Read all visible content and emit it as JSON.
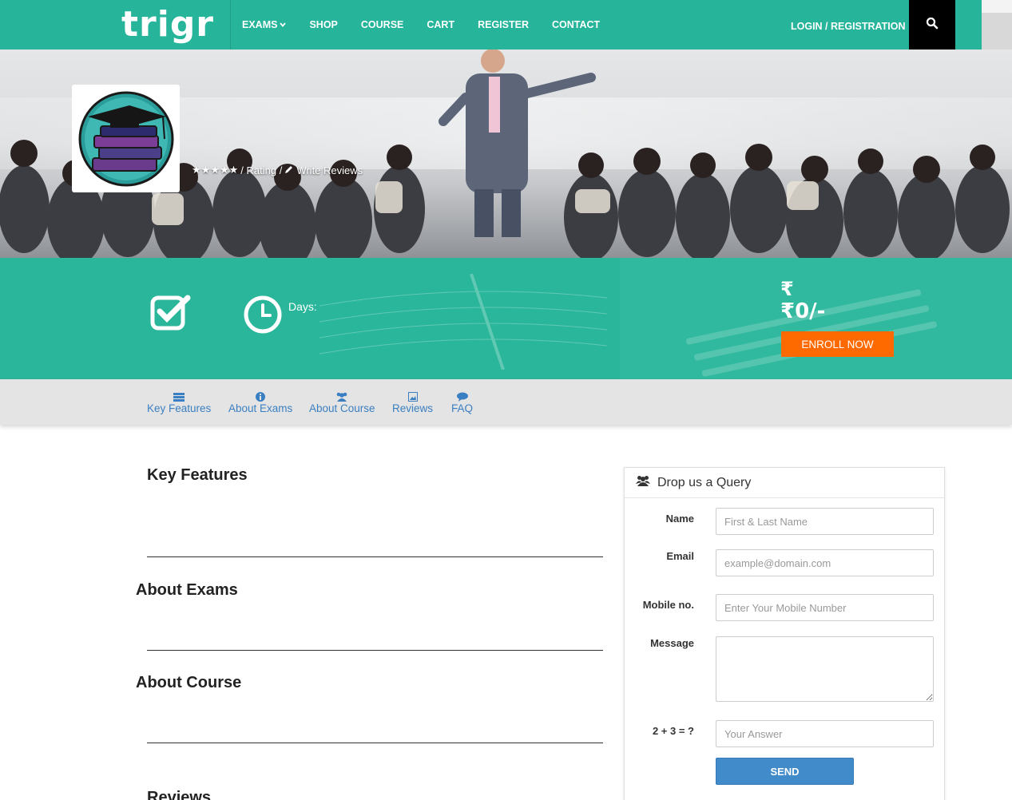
{
  "brand": {
    "logo_text": "trigr"
  },
  "nav": {
    "items": [
      {
        "label": "EXAMS",
        "has_dropdown": true
      },
      {
        "label": "SHOP"
      },
      {
        "label": "COURSE"
      },
      {
        "label": "CART"
      },
      {
        "label": "REGISTER"
      },
      {
        "label": "CONTACT"
      }
    ],
    "login_label": "LOGIN / REGISTRATION",
    "search_icon": "search-icon"
  },
  "hero": {
    "rating_text": "/ Rating /",
    "write_reviews": "Write Reviews",
    "stars": 5
  },
  "course_info": {
    "days_label": "Days:",
    "currency_symbol": "₹",
    "price": "₹0/-",
    "enroll_label": "ENROLL NOW"
  },
  "tabs": [
    {
      "label": "Key Features",
      "icon": "list-icon"
    },
    {
      "label": "About Exams",
      "icon": "info-icon"
    },
    {
      "label": "About Course",
      "icon": "users-icon"
    },
    {
      "label": "Reviews",
      "icon": "image-icon"
    },
    {
      "label": "FAQ",
      "icon": "comment-icon"
    }
  ],
  "sections": {
    "key_features": "Key Features",
    "about_exams": "About Exams",
    "about_course": "About Course",
    "reviews": "Reviews"
  },
  "query_form": {
    "title": "Drop us a Query",
    "name_label": "Name",
    "name_placeholder": "First & Last Name",
    "email_label": "Email",
    "email_placeholder": "example@domain.com",
    "mobile_label": "Mobile no.",
    "mobile_placeholder": "Enter Your Mobile Number",
    "message_label": "Message",
    "captcha_label": "2 + 3 = ?",
    "captcha_placeholder": "Your Answer",
    "send_label": "SEND"
  },
  "colors": {
    "brand_teal": "#26b49a",
    "enroll_orange": "#ff6a00",
    "tab_link_blue": "#3a7fc1",
    "send_blue": "#428bca"
  }
}
